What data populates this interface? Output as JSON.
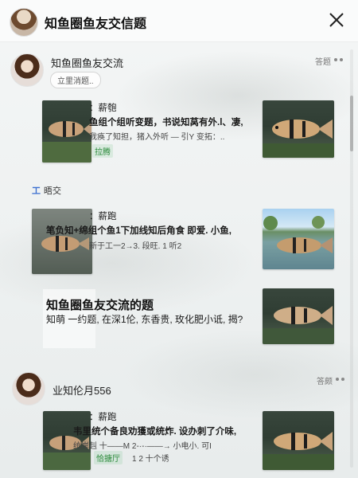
{
  "header": {
    "title": "知鱼圈鱼友交信题"
  },
  "post1": {
    "author": "知鱼圈鱼友交流",
    "pill": "立里消题..",
    "tag": "答题",
    "line1": "：薪匏",
    "line2": "鱼组个组听变题，书说知莴有外.l、凄,",
    "line3": "我痪了知担，猪入外听 — 引Y 变拓：..",
    "chip": "拉腾"
  },
  "section": {
    "icon": "工",
    "label": "晤交"
  },
  "post2": {
    "line1": "：薪跑",
    "line2": "笔负知+绵组个鱼1下加线知后角食 即爱. 小鱼,",
    "line3": "新于工一2→3. 段旺. 1 听2"
  },
  "post3": {
    "title": "知鱼圈鱼友交流的题",
    "body": "知萌 一约题, 在深1伦, 东香贵, 玫化肥小诋, 揭?"
  },
  "post4": {
    "author": "业知伦月556",
    "tag": "答颇",
    "line1": "：薪跑",
    "line2": "韦里统个备良劝獲或统炸. 设办刺了介味,",
    "line3": "统岸赳 十——M 2-·-·——→ 小电小. 可I",
    "chip": "恰搪厅",
    "chip_after": "1 2 十个诱"
  }
}
